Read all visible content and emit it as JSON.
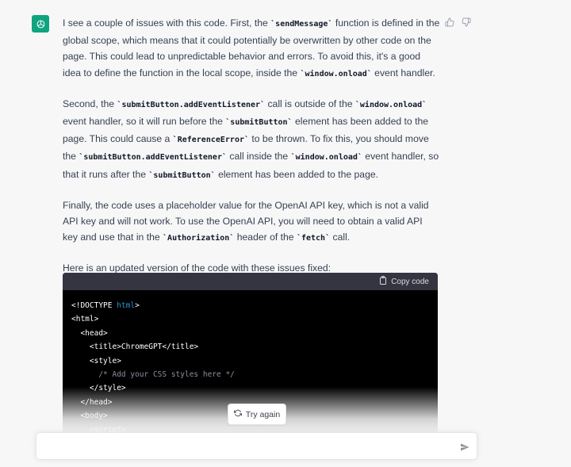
{
  "message": {
    "author_icon": "openai-logo-icon",
    "feedback": {
      "like_icon": "thumbs-up-icon",
      "dislike_icon": "thumbs-down-icon"
    },
    "paragraphs": [
      [
        {
          "t": "I see a couple of issues with this code. First, the "
        },
        {
          "c": "`sendMessage`"
        },
        {
          "t": " function is defined in the global scope, which means that it could potentially be overwritten by other code on the page. This could lead to unpredictable behavior and errors. To avoid this, it's a good idea to define the function in the local scope, inside the "
        },
        {
          "c": "`window.onload`"
        },
        {
          "t": " event handler."
        }
      ],
      [
        {
          "t": "Second, the "
        },
        {
          "c": "`submitButton.addEventListener`"
        },
        {
          "t": " call is outside of the "
        },
        {
          "c": "`window.onload`"
        },
        {
          "t": " event handler, so it will run before the "
        },
        {
          "c": "`submitButton`"
        },
        {
          "t": " element has been added to the page. This could cause a "
        },
        {
          "c": "`ReferenceError`"
        },
        {
          "t": " to be thrown. To fix this, you should move the "
        },
        {
          "c": "`submitButton.addEventListener`"
        },
        {
          "t": " call inside the "
        },
        {
          "c": "`window.onload`"
        },
        {
          "t": " event handler, so that it runs after the "
        },
        {
          "c": "`submitButton`"
        },
        {
          "t": " element has been added to the page."
        }
      ],
      [
        {
          "t": "Finally, the code uses a placeholder value for the OpenAI API key, which is not a valid API key and will not work. To use the OpenAI API, you will need to obtain a valid API key and use that in the "
        },
        {
          "c": "`Authorization`"
        },
        {
          "t": " header of the "
        },
        {
          "c": "`fetch`"
        },
        {
          "t": " call."
        }
      ],
      [
        {
          "t": "Here is an updated version of the code with these issues fixed:"
        }
      ]
    ],
    "code_block": {
      "copy_label": "Copy code",
      "copy_icon": "clipboard-icon",
      "lines": [
        [
          {
            "t": "<!DOCTYPE "
          },
          {
            "k": "html"
          },
          {
            "t": ">"
          }
        ],
        [
          {
            "t": "<html>"
          }
        ],
        [
          {
            "t": "  <head>"
          }
        ],
        [
          {
            "t": "    <title>ChromeGPT</title>"
          }
        ],
        [
          {
            "t": "    <style>"
          }
        ],
        [
          {
            "m": "      /* Add your CSS styles here */"
          }
        ],
        [
          {
            "t": "    </style>"
          }
        ],
        [
          {
            "t": "  </head>"
          }
        ],
        [
          {
            "t": "  <body>"
          }
        ],
        [
          {
            "t": "    <script>"
          }
        ]
      ]
    }
  },
  "regenerate": {
    "label": "Try again",
    "icon": "refresh-icon"
  },
  "composer": {
    "placeholder": "",
    "value": "",
    "send_icon": "send-icon"
  }
}
